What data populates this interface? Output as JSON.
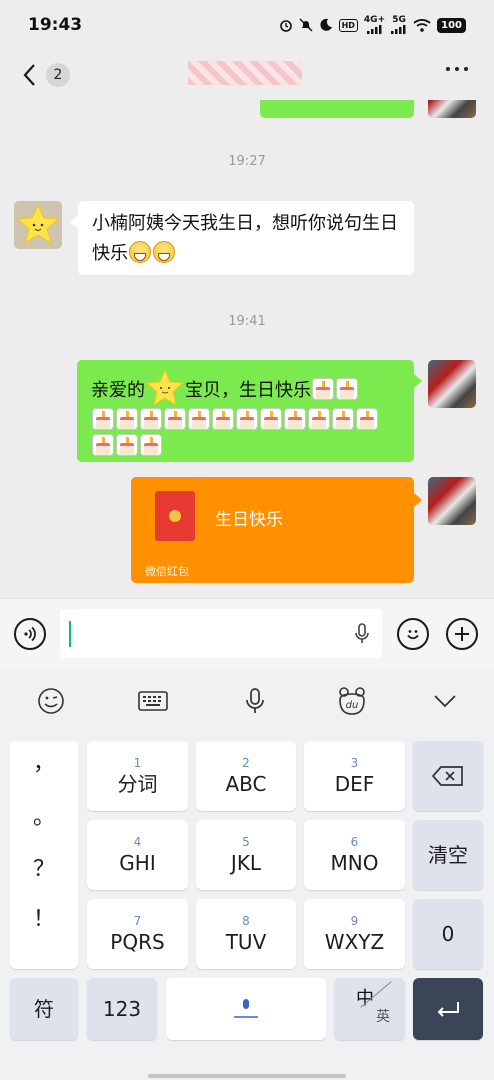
{
  "status_bar": {
    "time": "19:43",
    "hd_label": "HD",
    "net1": "4G+",
    "net2": "5G",
    "battery": "100"
  },
  "header": {
    "unread_count": "2"
  },
  "messages": {
    "time1": "19:27",
    "incoming_text": "小楠阿姨今天我生日，想听你说句生日快乐",
    "time2": "19:41",
    "outgoing_prefix": "亲爱的",
    "outgoing_middle": "宝贝，生日快乐",
    "red_packet_title": "生日快乐",
    "red_packet_label": "微信红包"
  },
  "keyboard": {
    "toolbar_icons": [
      "emoji-icon",
      "keyboard-icon",
      "mic-icon",
      "baidu-icon",
      "chevron-down-icon"
    ],
    "punctuation": [
      "，",
      "。",
      "？",
      "！"
    ],
    "keys": [
      {
        "num": "1",
        "label": "分词"
      },
      {
        "num": "2",
        "label": "ABC"
      },
      {
        "num": "3",
        "label": "DEF"
      },
      {
        "num": "4",
        "label": "GHI"
      },
      {
        "num": "5",
        "label": "JKL"
      },
      {
        "num": "6",
        "label": "MNO"
      },
      {
        "num": "7",
        "label": "PQRS"
      },
      {
        "num": "8",
        "label": "TUV"
      },
      {
        "num": "9",
        "label": "WXYZ"
      }
    ],
    "clear_label": "清空",
    "zero_label": "0",
    "symbol_label": "符",
    "num_label": "123",
    "zh_label": "中",
    "en_label": "英"
  },
  "colors": {
    "outgoing_bubble": "#7bea4f",
    "incoming_bubble": "#ffffff",
    "red_packet": "#ff9000",
    "chat_bg": "#ededed",
    "enter_key": "#3a4558"
  }
}
